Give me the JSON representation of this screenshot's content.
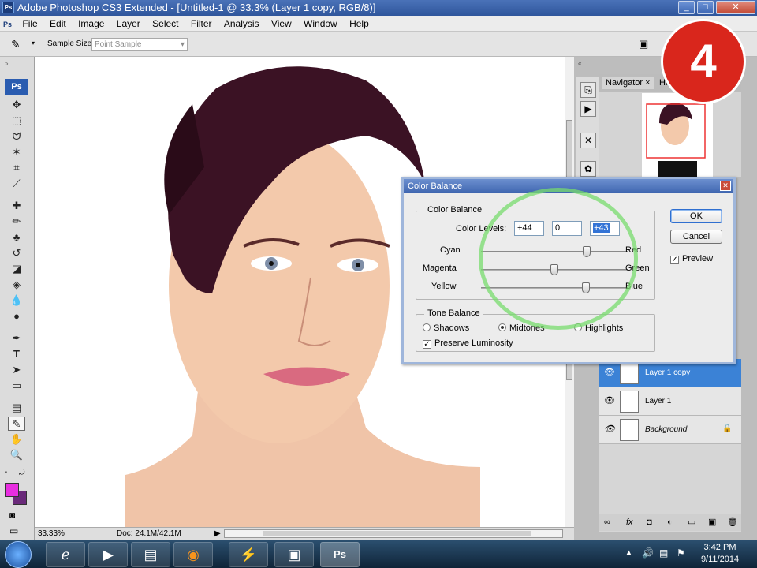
{
  "window": {
    "title": "Adobe Photoshop CS3 Extended - [Untitled-1 @ 33.3% (Layer 1 copy, RGB/8)]",
    "app_icon": "Ps"
  },
  "menu": [
    "File",
    "Edit",
    "Image",
    "Layer",
    "Select",
    "Filter",
    "Analysis",
    "View",
    "Window",
    "Help"
  ],
  "options": {
    "sample_size_label": "Sample Size:",
    "sample_size_value": "Point Sample"
  },
  "status": {
    "zoom": "33.33%",
    "doc": "Doc: 24.1M/42.1M"
  },
  "dialog": {
    "title": "Color Balance",
    "color_balance_group": "Color Balance",
    "color_levels_label": "Color Levels:",
    "levels": [
      "+44",
      "0",
      "+43"
    ],
    "sliders": [
      {
        "left": "Cyan",
        "right": "Red",
        "value": 44
      },
      {
        "left": "Magenta",
        "right": "Green",
        "value": 0
      },
      {
        "left": "Yellow",
        "right": "Blue",
        "value": 43
      }
    ],
    "tone_group": "Tone Balance",
    "tones": [
      "Shadows",
      "Midtones",
      "Highlights"
    ],
    "selected_tone": "Midtones",
    "preserve_luminosity": "Preserve Luminosity",
    "ok": "OK",
    "cancel": "Cancel",
    "preview": "Preview"
  },
  "navigator": {
    "tab": "Navigator",
    "tab2": "Hi"
  },
  "layers": [
    {
      "name": "Layer 1 copy",
      "selected": true
    },
    {
      "name": "Layer 1",
      "selected": false
    },
    {
      "name": "Background",
      "selected": false
    }
  ],
  "badge": "4",
  "clock": {
    "time": "3:42 PM",
    "date": "9/11/2014"
  },
  "colors": {
    "foreground": "#e82ee0",
    "background": "#6a2a7a",
    "accent_circle": "#7ddc6e",
    "badge": "#d9261c"
  }
}
